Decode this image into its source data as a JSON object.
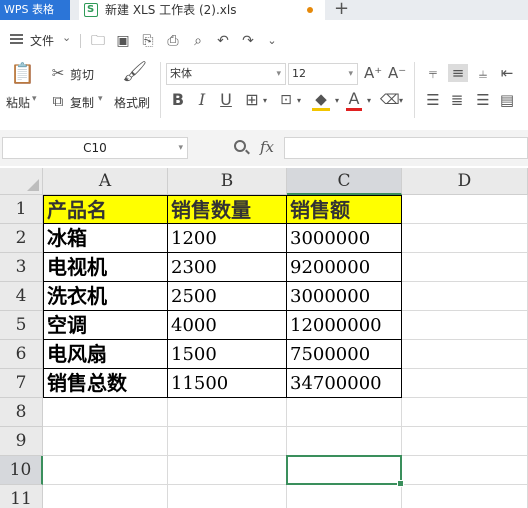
{
  "tabs": {
    "app_label": "WPS 表格",
    "doc_title": "新建 XLS 工作表 (2).xls",
    "new_tab_symbol": "+"
  },
  "menu": {
    "file_label": "文件",
    "file_chevron": "⌄"
  },
  "ribbon": {
    "paste_label": "粘贴",
    "cut_label": "剪切",
    "copy_label": "复制",
    "format_painter_label": "格式刷",
    "font_name": "宋体",
    "font_size": "12",
    "grow_font": "A⁺",
    "shrink_font": "A⁻",
    "bold": "B",
    "italic": "I",
    "underline": "U",
    "font_color_letter": "A"
  },
  "formula_bar": {
    "name_box": "C10",
    "fx_label": "fx",
    "formula": ""
  },
  "sheet": {
    "columns": [
      "A",
      "B",
      "C",
      "D"
    ],
    "rows": [
      "1",
      "2",
      "3",
      "4",
      "5",
      "6",
      "7",
      "8",
      "9",
      "10",
      "11"
    ],
    "selected_cell": "C10",
    "header_fill": "#ffff00",
    "selection_color": "#3a8f5c",
    "table": {
      "headers": [
        "产品名",
        "销售数量",
        "销售额"
      ],
      "rows": [
        [
          "冰箱",
          "1200",
          "3000000"
        ],
        [
          "电视机",
          "2300",
          "9200000"
        ],
        [
          "洗衣机",
          "2500",
          "3000000"
        ],
        [
          "空调",
          "4000",
          "12000000"
        ],
        [
          "电风扇",
          "1500",
          "7500000"
        ],
        [
          "销售总数",
          "11500",
          "34700000"
        ]
      ]
    }
  },
  "colors": {
    "app_tab": "#2b75d8",
    "tab_bar": "#e9ecf0",
    "unsaved_dot": "#e6890a"
  }
}
